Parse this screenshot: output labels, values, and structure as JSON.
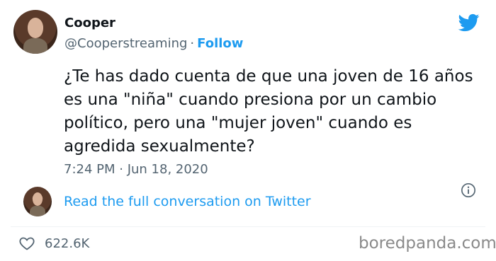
{
  "author": {
    "name": "Cooper",
    "handle": "@Cooperstreaming",
    "separator": "·",
    "follow_label": "Follow"
  },
  "tweet": {
    "text": "¿Te has dado cuenta de que una joven de 16 años es una \"niña\" cuando presiona por un cambio político, pero una \"mujer joven\" cuando es agredida sexualmente?",
    "time": "7:24 PM · Jun 18, 2020"
  },
  "conversation_link": "Read the full conversation on Twitter",
  "likes": "622.6K",
  "watermark": "boredpanda.com",
  "icons": {
    "brand": "twitter-bird-icon",
    "info": "info-icon",
    "like": "heart-icon"
  },
  "colors": {
    "accent": "#1d9bf0",
    "secondary_text": "#536471",
    "primary_text": "#0f1419"
  }
}
